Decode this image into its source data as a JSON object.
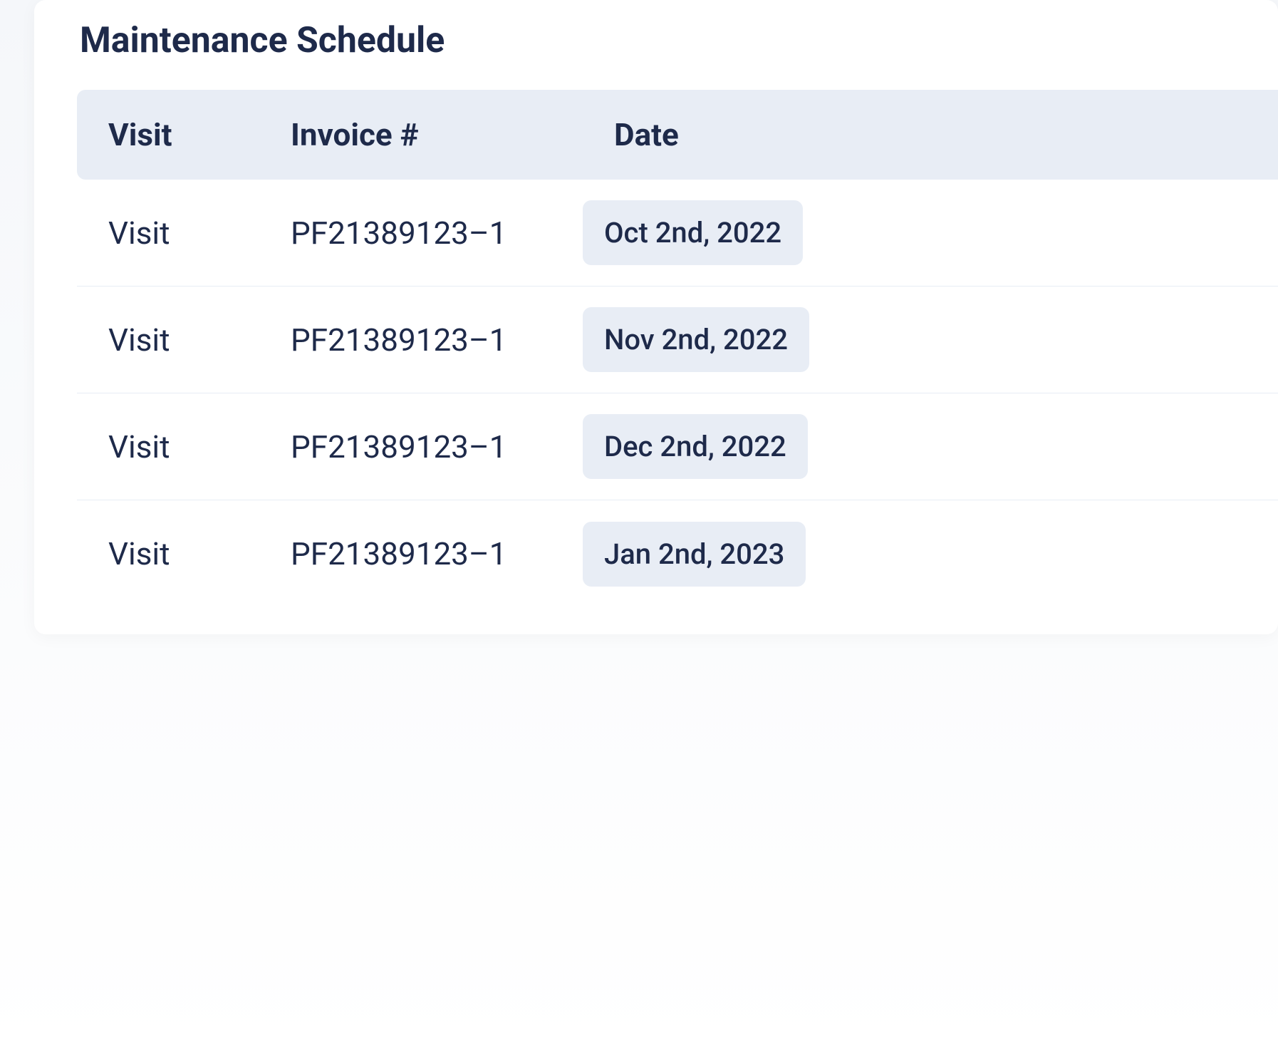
{
  "card": {
    "title": "Maintenance Schedule"
  },
  "table": {
    "headers": {
      "visit": "Visit",
      "invoice": "Invoice #",
      "date": "Date"
    },
    "rows": [
      {
        "visit": "Visit",
        "invoice": "PF21389123–1",
        "date": "Oct 2nd, 2022"
      },
      {
        "visit": "Visit",
        "invoice": "PF21389123–1",
        "date": "Nov 2nd, 2022"
      },
      {
        "visit": "Visit",
        "invoice": "PF21389123–1",
        "date": "Dec 2nd, 2022"
      },
      {
        "visit": "Visit",
        "invoice": "PF21389123–1",
        "date": "Jan 2nd, 2023"
      }
    ]
  }
}
